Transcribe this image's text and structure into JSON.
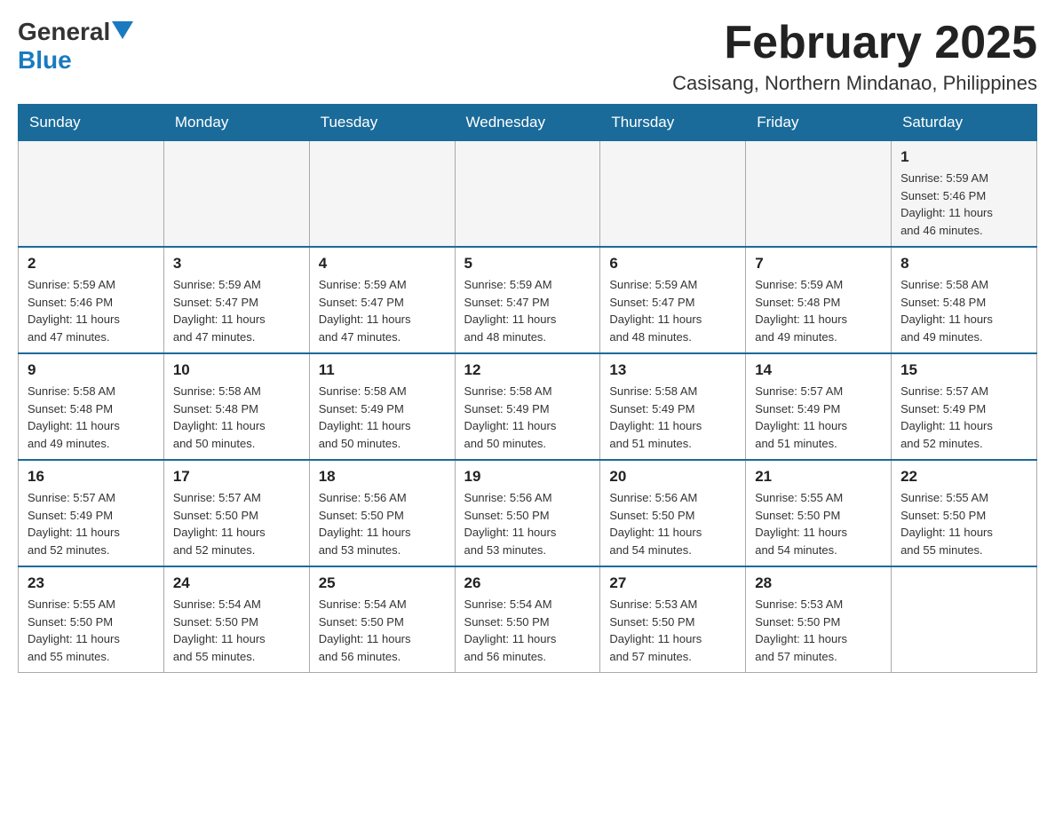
{
  "header": {
    "logo_general": "General",
    "logo_blue": "Blue",
    "month_title": "February 2025",
    "location": "Casisang, Northern Mindanao, Philippines"
  },
  "days_of_week": [
    "Sunday",
    "Monday",
    "Tuesday",
    "Wednesday",
    "Thursday",
    "Friday",
    "Saturday"
  ],
  "weeks": [
    [
      {
        "day": "",
        "info": ""
      },
      {
        "day": "",
        "info": ""
      },
      {
        "day": "",
        "info": ""
      },
      {
        "day": "",
        "info": ""
      },
      {
        "day": "",
        "info": ""
      },
      {
        "day": "",
        "info": ""
      },
      {
        "day": "1",
        "info": "Sunrise: 5:59 AM\nSunset: 5:46 PM\nDaylight: 11 hours\nand 46 minutes."
      }
    ],
    [
      {
        "day": "2",
        "info": "Sunrise: 5:59 AM\nSunset: 5:46 PM\nDaylight: 11 hours\nand 47 minutes."
      },
      {
        "day": "3",
        "info": "Sunrise: 5:59 AM\nSunset: 5:47 PM\nDaylight: 11 hours\nand 47 minutes."
      },
      {
        "day": "4",
        "info": "Sunrise: 5:59 AM\nSunset: 5:47 PM\nDaylight: 11 hours\nand 47 minutes."
      },
      {
        "day": "5",
        "info": "Sunrise: 5:59 AM\nSunset: 5:47 PM\nDaylight: 11 hours\nand 48 minutes."
      },
      {
        "day": "6",
        "info": "Sunrise: 5:59 AM\nSunset: 5:47 PM\nDaylight: 11 hours\nand 48 minutes."
      },
      {
        "day": "7",
        "info": "Sunrise: 5:59 AM\nSunset: 5:48 PM\nDaylight: 11 hours\nand 49 minutes."
      },
      {
        "day": "8",
        "info": "Sunrise: 5:58 AM\nSunset: 5:48 PM\nDaylight: 11 hours\nand 49 minutes."
      }
    ],
    [
      {
        "day": "9",
        "info": "Sunrise: 5:58 AM\nSunset: 5:48 PM\nDaylight: 11 hours\nand 49 minutes."
      },
      {
        "day": "10",
        "info": "Sunrise: 5:58 AM\nSunset: 5:48 PM\nDaylight: 11 hours\nand 50 minutes."
      },
      {
        "day": "11",
        "info": "Sunrise: 5:58 AM\nSunset: 5:49 PM\nDaylight: 11 hours\nand 50 minutes."
      },
      {
        "day": "12",
        "info": "Sunrise: 5:58 AM\nSunset: 5:49 PM\nDaylight: 11 hours\nand 50 minutes."
      },
      {
        "day": "13",
        "info": "Sunrise: 5:58 AM\nSunset: 5:49 PM\nDaylight: 11 hours\nand 51 minutes."
      },
      {
        "day": "14",
        "info": "Sunrise: 5:57 AM\nSunset: 5:49 PM\nDaylight: 11 hours\nand 51 minutes."
      },
      {
        "day": "15",
        "info": "Sunrise: 5:57 AM\nSunset: 5:49 PM\nDaylight: 11 hours\nand 52 minutes."
      }
    ],
    [
      {
        "day": "16",
        "info": "Sunrise: 5:57 AM\nSunset: 5:49 PM\nDaylight: 11 hours\nand 52 minutes."
      },
      {
        "day": "17",
        "info": "Sunrise: 5:57 AM\nSunset: 5:50 PM\nDaylight: 11 hours\nand 52 minutes."
      },
      {
        "day": "18",
        "info": "Sunrise: 5:56 AM\nSunset: 5:50 PM\nDaylight: 11 hours\nand 53 minutes."
      },
      {
        "day": "19",
        "info": "Sunrise: 5:56 AM\nSunset: 5:50 PM\nDaylight: 11 hours\nand 53 minutes."
      },
      {
        "day": "20",
        "info": "Sunrise: 5:56 AM\nSunset: 5:50 PM\nDaylight: 11 hours\nand 54 minutes."
      },
      {
        "day": "21",
        "info": "Sunrise: 5:55 AM\nSunset: 5:50 PM\nDaylight: 11 hours\nand 54 minutes."
      },
      {
        "day": "22",
        "info": "Sunrise: 5:55 AM\nSunset: 5:50 PM\nDaylight: 11 hours\nand 55 minutes."
      }
    ],
    [
      {
        "day": "23",
        "info": "Sunrise: 5:55 AM\nSunset: 5:50 PM\nDaylight: 11 hours\nand 55 minutes."
      },
      {
        "day": "24",
        "info": "Sunrise: 5:54 AM\nSunset: 5:50 PM\nDaylight: 11 hours\nand 55 minutes."
      },
      {
        "day": "25",
        "info": "Sunrise: 5:54 AM\nSunset: 5:50 PM\nDaylight: 11 hours\nand 56 minutes."
      },
      {
        "day": "26",
        "info": "Sunrise: 5:54 AM\nSunset: 5:50 PM\nDaylight: 11 hours\nand 56 minutes."
      },
      {
        "day": "27",
        "info": "Sunrise: 5:53 AM\nSunset: 5:50 PM\nDaylight: 11 hours\nand 57 minutes."
      },
      {
        "day": "28",
        "info": "Sunrise: 5:53 AM\nSunset: 5:50 PM\nDaylight: 11 hours\nand 57 minutes."
      },
      {
        "day": "",
        "info": ""
      }
    ]
  ]
}
